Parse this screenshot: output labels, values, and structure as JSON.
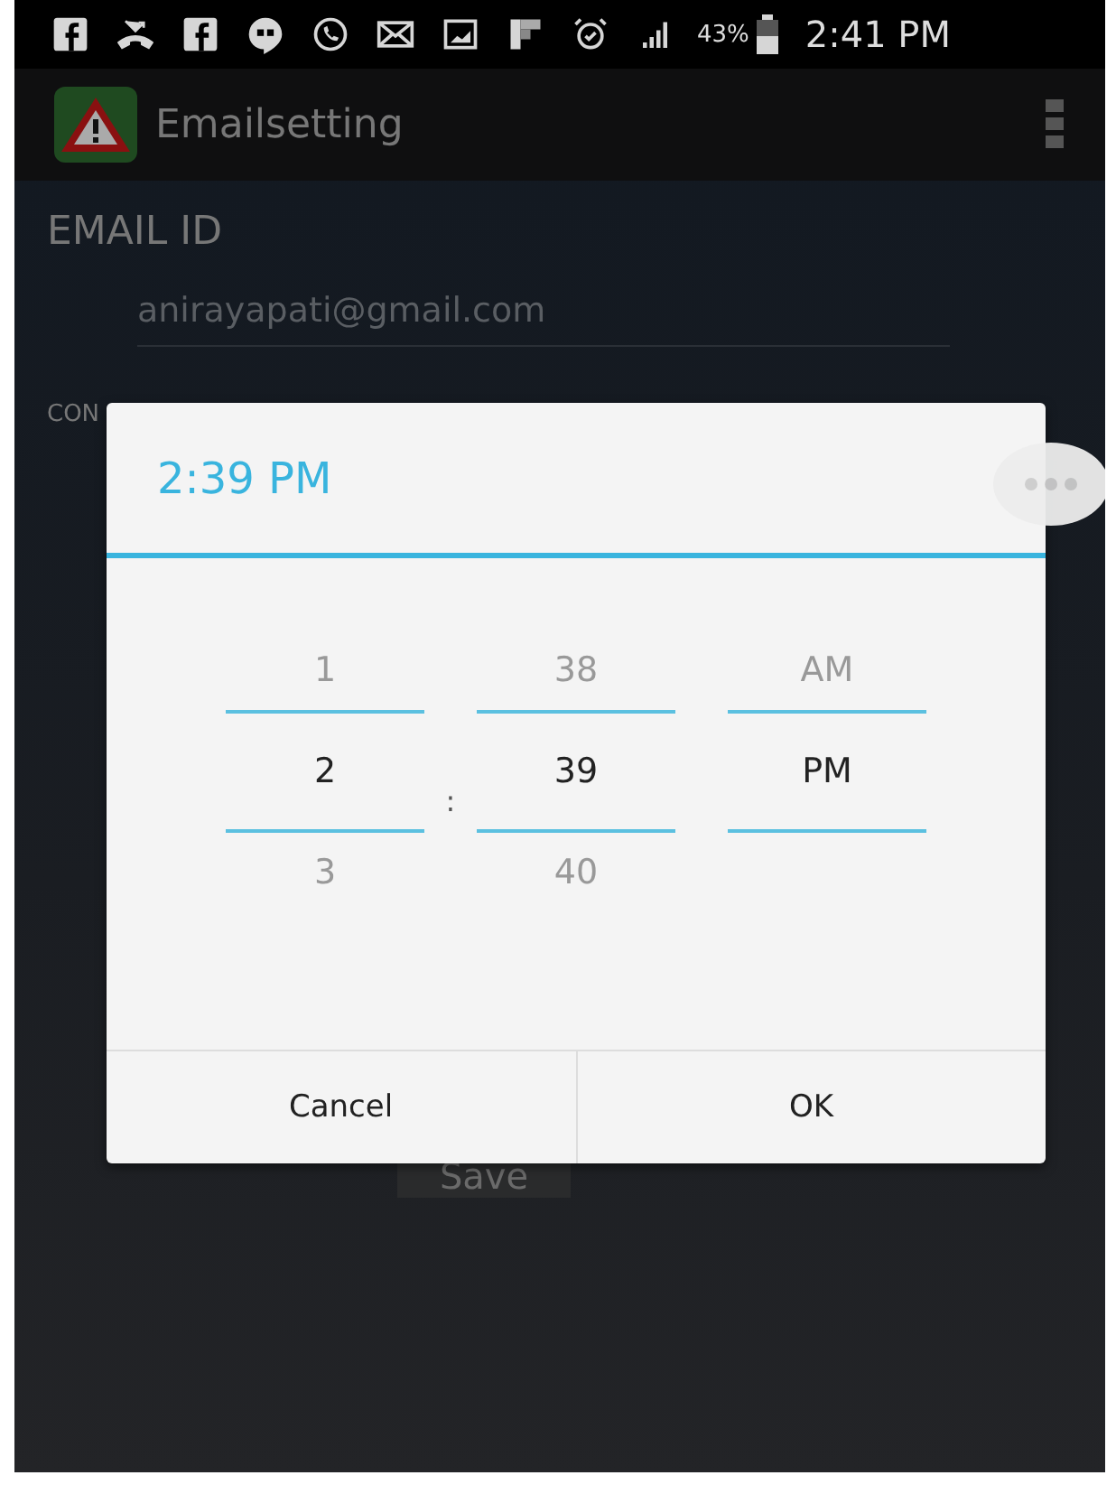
{
  "status_bar": {
    "battery_percent": "43%",
    "time": "2:41 PM"
  },
  "app_bar": {
    "title": "Emailsetting"
  },
  "form": {
    "email_label": "EMAIL ID",
    "email_value": "anirayapati@gmail.com",
    "partial_label": "CON",
    "save_button": "Save"
  },
  "time_dialog": {
    "title": "2:39 PM",
    "separator": ":",
    "columns": [
      {
        "above": "1",
        "value": "2",
        "below": "3"
      },
      {
        "above": "38",
        "value": "39",
        "below": "40"
      },
      {
        "above": "AM",
        "value": "PM"
      }
    ],
    "buttons": [
      "Cancel",
      "OK"
    ]
  }
}
